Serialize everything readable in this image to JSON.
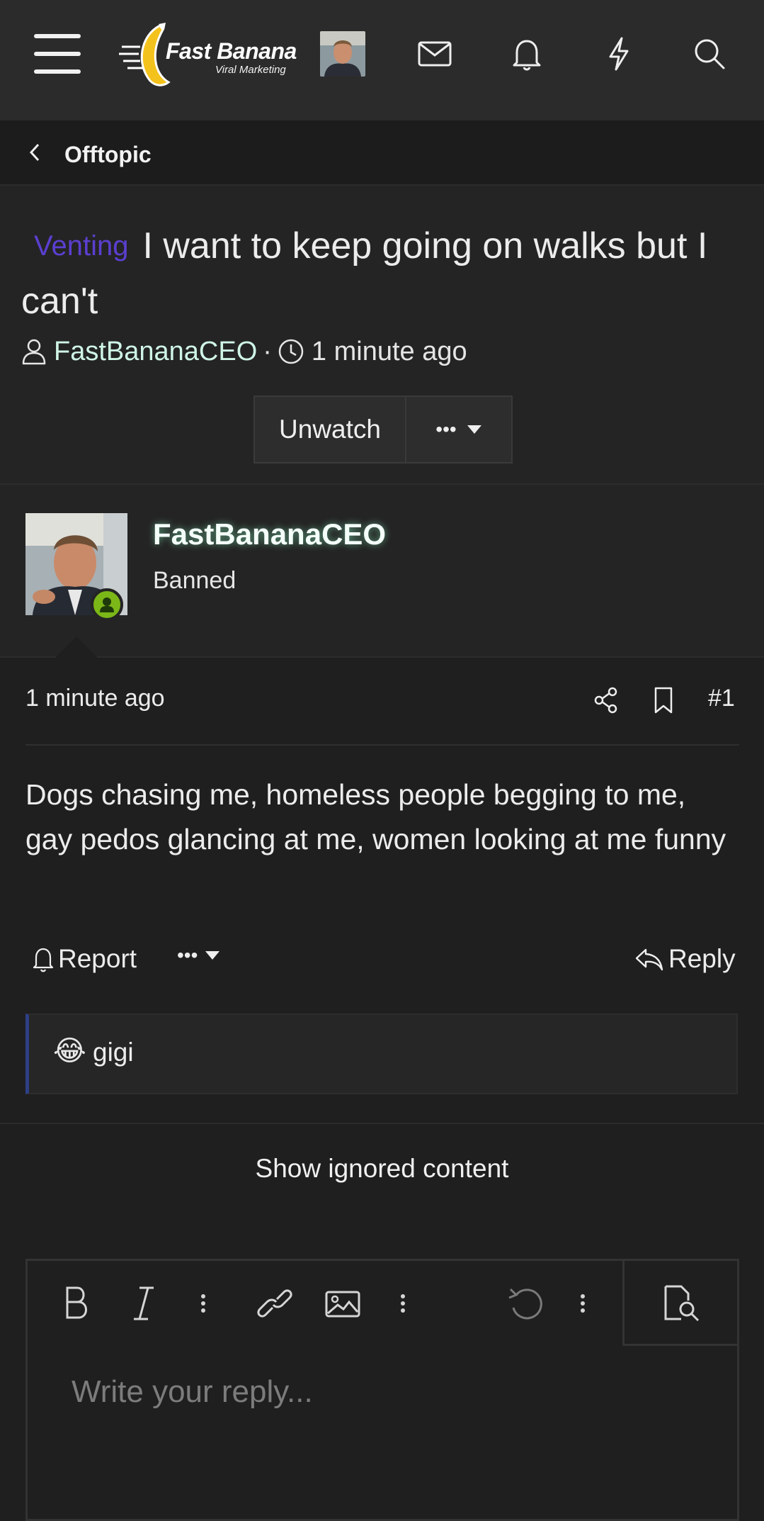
{
  "header": {
    "logo_title": "Fast Banana",
    "logo_subtitle": "Viral Marketing"
  },
  "breadcrumb": {
    "label": "Offtopic"
  },
  "thread": {
    "prefix": "Venting",
    "title": "I want to keep going on walks but I can't",
    "author": "FastBananaCEO",
    "time": "1 minute ago",
    "unwatch_label": "Unwatch",
    "more_label": "•••"
  },
  "post": {
    "username": "FastBananaCEO",
    "user_title": "Banned",
    "time": "1 minute ago",
    "number": "#1",
    "body": "Dogs chasing me, homeless people begging to me, gay pedos glancing at me, women looking at me funny",
    "report_label": "Report",
    "more_label": "•••",
    "reply_label": "Reply",
    "reaction_emoji": "😂",
    "reaction_user": "gigi"
  },
  "ignored": {
    "label": "Show ignored content"
  },
  "editor": {
    "placeholder": "Write your reply..."
  },
  "colors": {
    "header_bg": "#2b2b2b",
    "page_bg": "#1f1f1f",
    "prefix": "#5b3fd0",
    "online": "#7cb718",
    "reaction_accent": "#2d3f86"
  }
}
